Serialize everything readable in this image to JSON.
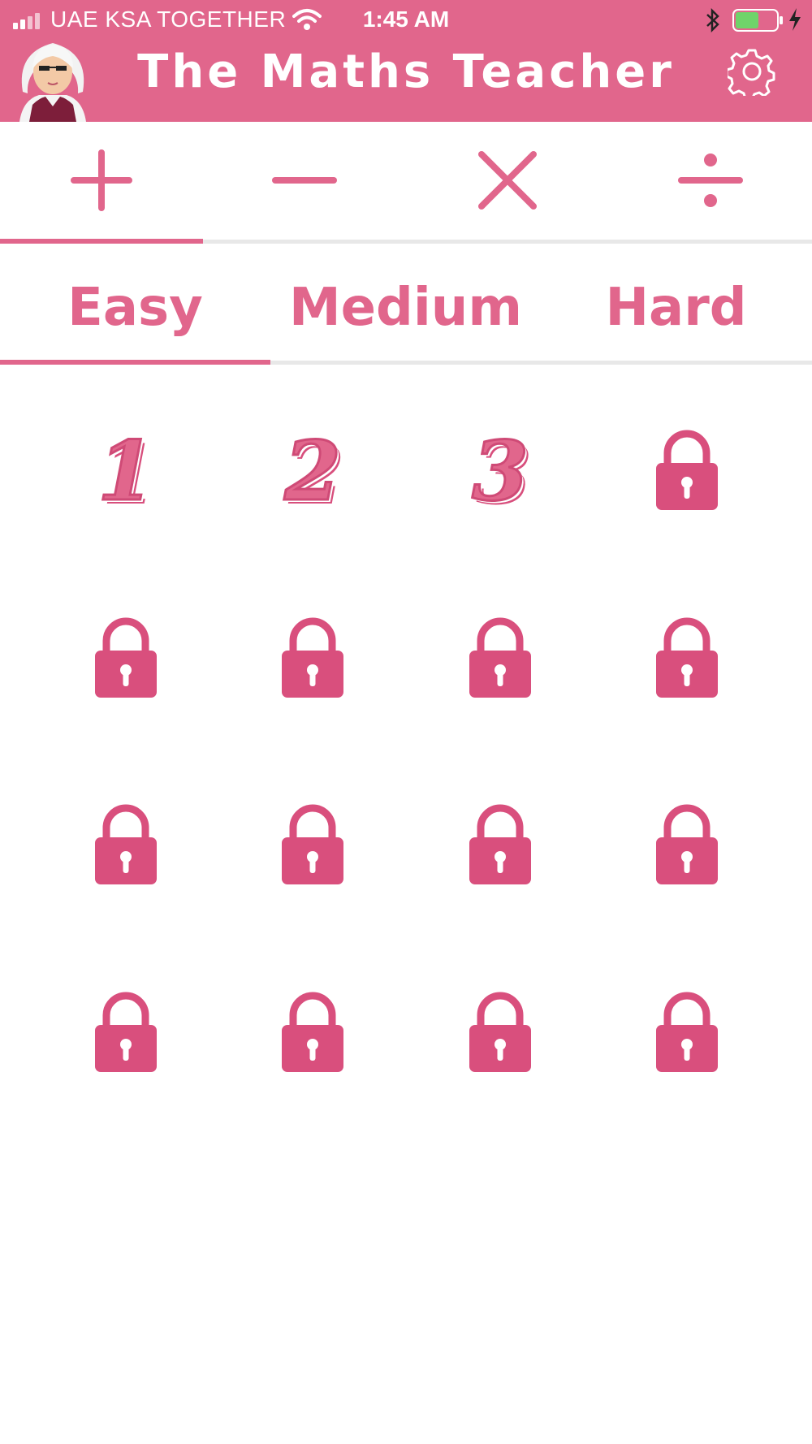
{
  "status_bar": {
    "carrier": "UAE KSA TOGETHER",
    "time": "1:45 AM",
    "battery_color": "#6fd36a"
  },
  "header": {
    "title": "The Maths Teacher",
    "background": "#e1668c",
    "avatar_icon": "teacher-avatar",
    "settings_icon": "gear-icon"
  },
  "operations": {
    "items": [
      {
        "name": "addition",
        "icon": "plus-icon"
      },
      {
        "name": "subtraction",
        "icon": "minus-icon"
      },
      {
        "name": "multiplication",
        "icon": "times-icon"
      },
      {
        "name": "division",
        "icon": "divide-icon"
      }
    ],
    "selected_index": 0
  },
  "difficulty": {
    "tabs": [
      "Easy",
      "Medium",
      "Hard"
    ],
    "selected_index": 0
  },
  "levels": {
    "unlocked": [
      "1",
      "2",
      "3"
    ],
    "locked_count": 13,
    "lock_icon": "lock-icon"
  },
  "accent": "#e1668c",
  "lock_color": "#d94f7d"
}
